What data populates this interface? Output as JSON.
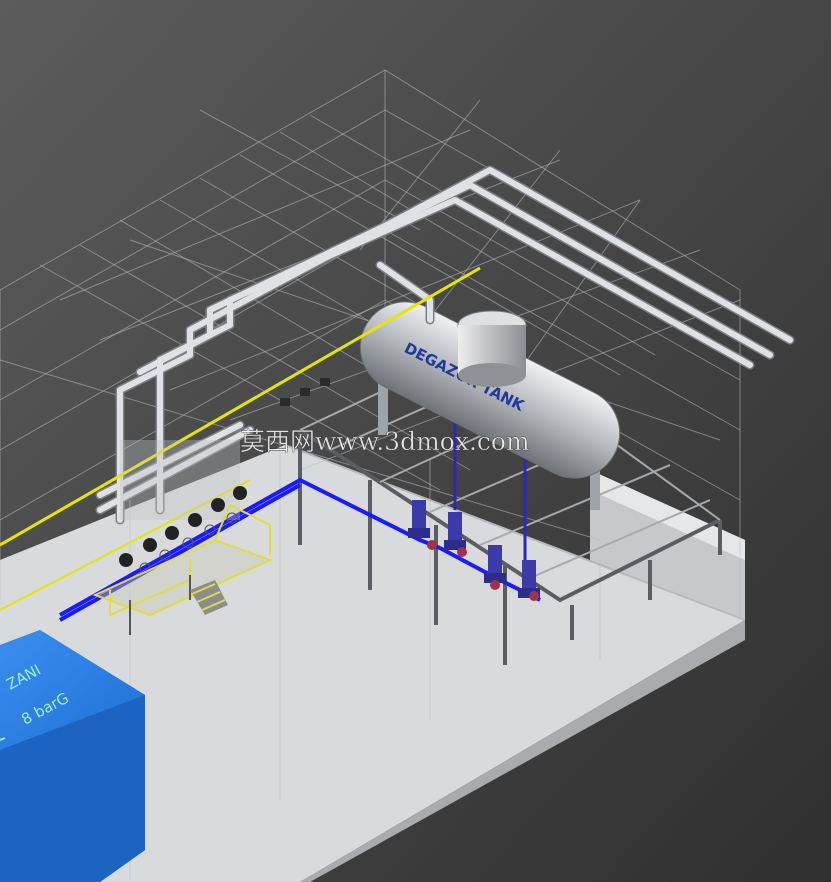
{
  "viewport": {
    "background_top": "#5c5c5c",
    "background_bottom": "#2f2f2f"
  },
  "tank": {
    "label": "DEGAZÖR TANK",
    "color": "#b9bcc1",
    "label_color": "#1f3a9a"
  },
  "boiler": {
    "line1": "ZANI",
    "line2": "8 barG",
    "color": "#1f6fd6",
    "label_color": "#9ff0ff"
  },
  "watermark": {
    "text": "莫西网www.3dmox.com",
    "color": "#ffffff"
  },
  "colors": {
    "pipe": "#cfd2d6",
    "gas_line": "#e6e600",
    "water_line": "#1a1aff",
    "pump": "#3a3aa8",
    "frame": "#9ea3a8",
    "floor": "#d9dadc",
    "handrail": "#e2dc3c"
  }
}
